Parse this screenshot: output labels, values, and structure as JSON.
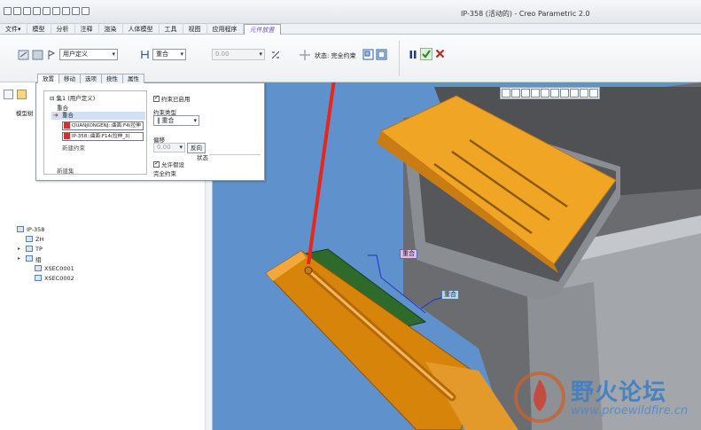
{
  "window": {
    "title": "IP-358 (活动的) - Creo Parametric 2.0"
  },
  "menu": {
    "items": [
      "文件▾",
      "模型",
      "分析",
      "注释",
      "渲染",
      "人体模型",
      "工具",
      "视图",
      "应用程序",
      "元件放置"
    ],
    "active_index": 9
  },
  "ribbon": {
    "constraint_set": "用户定义",
    "constraint_type": "重合",
    "offset": "0.00",
    "status": "状态: 完全约束",
    "colors": {
      "ok_check": "#2e8b2e",
      "cancel_x": "#d11f1f",
      "pause": "#1d3f8a"
    }
  },
  "subtabs": [
    "放置",
    "移动",
    "选项",
    "挠性",
    "属性"
  ],
  "popup": {
    "set_label": "集1 (用户定义)",
    "set_child": "重合",
    "selected_item": "重合",
    "ref1": "QUANJIONGENJ::曲面:F4(拉伸",
    "ref2": "IP-358::曲面:F14(拉伸_3)",
    "new_constraint": "新建约束",
    "new_set": "新建集",
    "enable_constraint": "约束已启用",
    "constraint_type_label": "约束类型",
    "constraint_type_value": "重合",
    "offset_label": "偏移",
    "offset_value": "0.00",
    "flip_button": "反向",
    "status_label": "状态",
    "allow_assume": "允许假设",
    "status_value": "完全约束"
  },
  "leftpane": {
    "model_tree_label": "模型树",
    "tree": [
      {
        "label": "IP-358",
        "indent": 0
      },
      {
        "label": "ZH",
        "indent": 1
      },
      {
        "label": "TP",
        "indent": 1
      },
      {
        "label": "组",
        "indent": 1
      },
      {
        "label": "XSEC0001",
        "indent": 2
      },
      {
        "label": "XSEC0002",
        "indent": 2
      }
    ]
  },
  "viewport": {
    "label1": "重合",
    "label2": "重合",
    "background": "#5f92cc"
  },
  "watermark": {
    "text": "野火论坛",
    "url": "www.proewildfire.cn"
  }
}
